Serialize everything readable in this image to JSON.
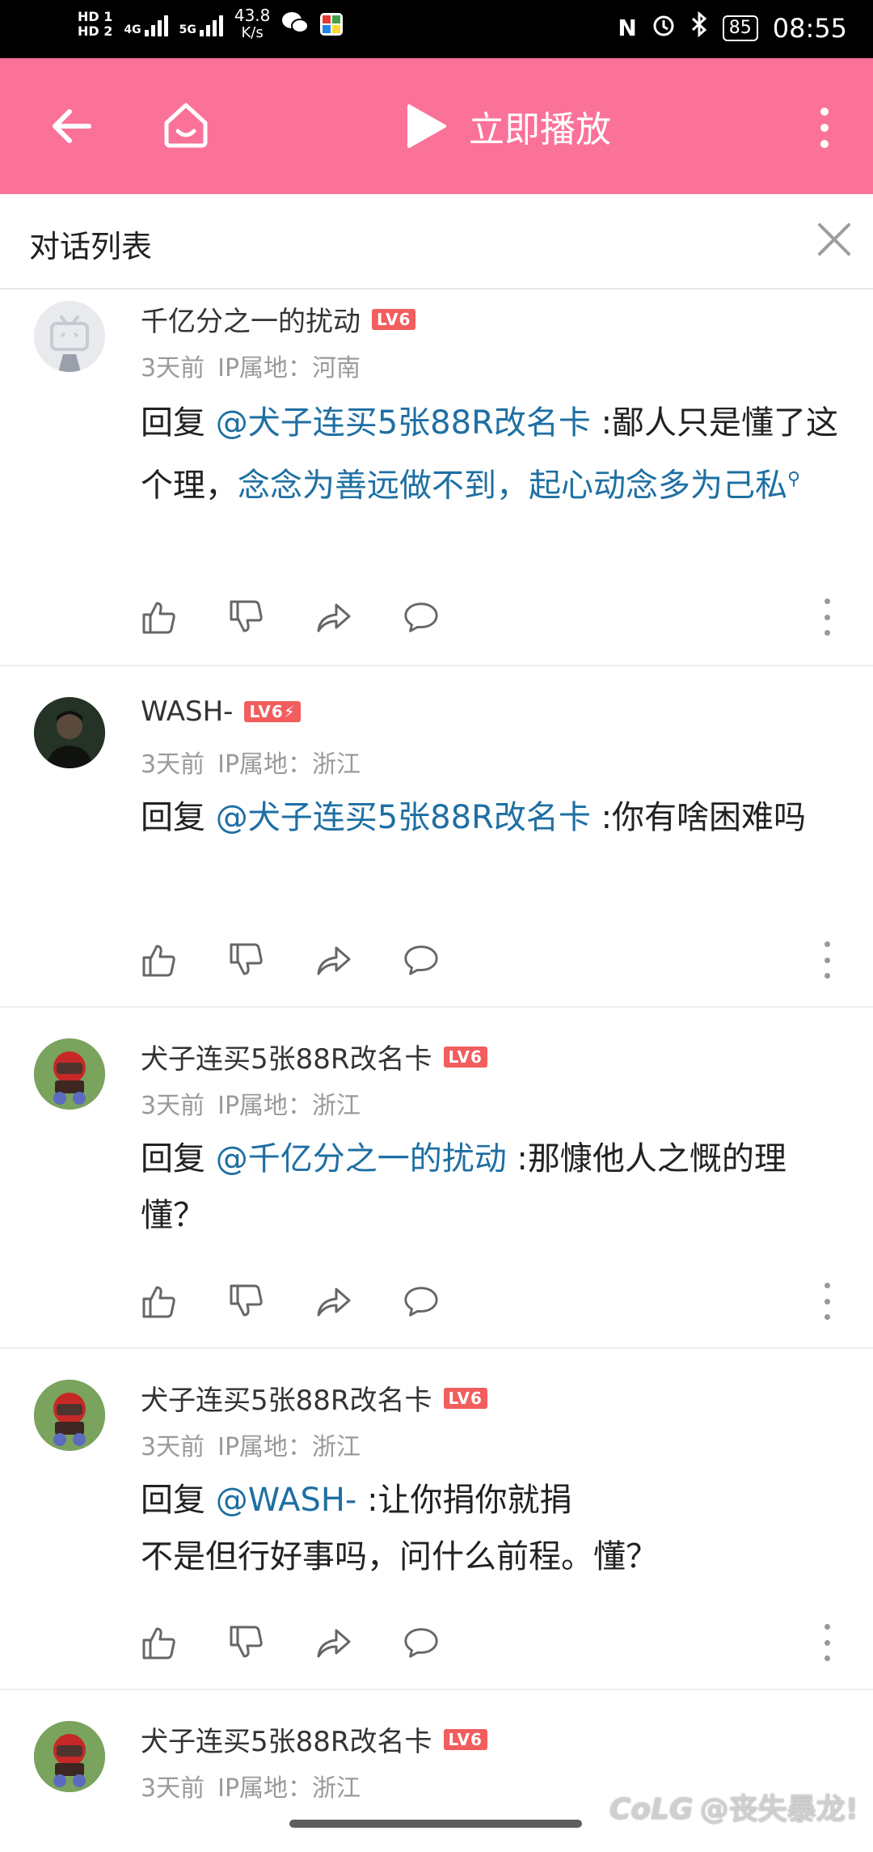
{
  "status_bar": {
    "hd1": "HD 1",
    "hd2": "HD 2",
    "net1": "4G",
    "net2": "5G",
    "speed": "43.8",
    "speed_unit": "K/s",
    "battery": "85",
    "time": "08:55"
  },
  "header": {
    "play_label": "立即播放",
    "colors": {
      "bar": "#fb7299"
    }
  },
  "dialog": {
    "title": "对话列表"
  },
  "comments": [
    {
      "name": "千亿分之一的扰动",
      "level": "LV6",
      "time": "3天前",
      "ip": "IP属地：河南",
      "reply_prefix": "回复 ",
      "mention": "@犬子连买5张88R改名卡",
      "text_plain": " :鄙人只是懂了这个理，",
      "text_link": "念念为善远做不到，起心动念多为己私",
      "text_after": ""
    },
    {
      "name": "WASH-",
      "level": "LV6⚡",
      "time": "3天前",
      "ip": "IP属地：浙江",
      "reply_prefix": "回复 ",
      "mention": "@犬子连买5张88R改名卡",
      "text_plain": " :你有啥困难吗",
      "text_link": "",
      "text_after": ""
    },
    {
      "name": "犬子连买5张88R改名卡",
      "level": "LV6",
      "time": "3天前",
      "ip": "IP属地：浙江",
      "reply_prefix": "回复 ",
      "mention": "@千亿分之一的扰动",
      "text_plain": " :那慷他人之慨的理  懂？",
      "text_link": "",
      "text_after": ""
    },
    {
      "name": "犬子连买5张88R改名卡",
      "level": "LV6",
      "time": "3天前",
      "ip": "IP属地：浙江",
      "reply_prefix": "回复 ",
      "mention": "@WASH-",
      "text_plain": " :让你捐你就捐",
      "text_link": "",
      "text_after": "不是但行好事吗，问什么前程。懂？"
    },
    {
      "name": "犬子连买5张88R改名卡",
      "level": "LV6",
      "time": "3天前",
      "ip": "IP属地：浙江"
    }
  ],
  "watermark": "@丧失暴龙!",
  "watermark_logo": "CoLG"
}
